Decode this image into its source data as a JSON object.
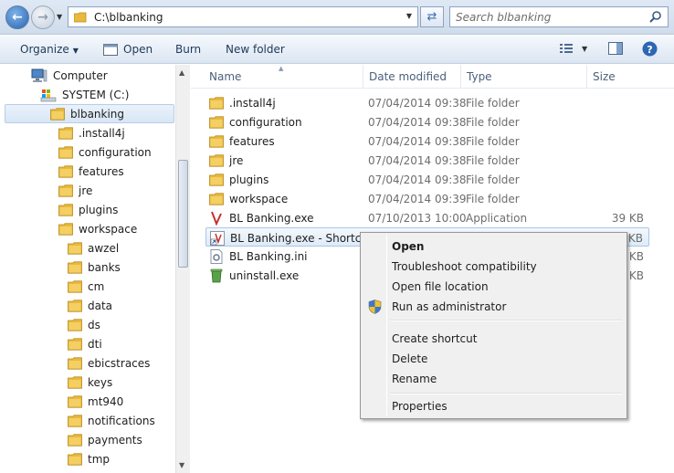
{
  "address": {
    "path": "C:\\blbanking"
  },
  "search": {
    "placeholder": "Search blbanking"
  },
  "toolbar": {
    "organize": "Organize",
    "open": "Open",
    "burn": "Burn",
    "new_folder": "New folder"
  },
  "nav_tree": [
    {
      "label": "Computer",
      "icon": "computer-icon",
      "indent": 0
    },
    {
      "label": "SYSTEM (C:)",
      "icon": "drive-icon",
      "indent": 1
    },
    {
      "label": "blbanking",
      "icon": "folder-icon",
      "indent": 2,
      "selected": true
    },
    {
      "label": ".install4j",
      "icon": "folder-icon",
      "indent": 3
    },
    {
      "label": "configuration",
      "icon": "folder-icon",
      "indent": 3
    },
    {
      "label": "features",
      "icon": "folder-icon",
      "indent": 3
    },
    {
      "label": "jre",
      "icon": "folder-icon",
      "indent": 3
    },
    {
      "label": "plugins",
      "icon": "folder-icon",
      "indent": 3
    },
    {
      "label": "workspace",
      "icon": "folder-icon",
      "indent": 3
    },
    {
      "label": "awzel",
      "icon": "folder-icon",
      "indent": 4
    },
    {
      "label": "banks",
      "icon": "folder-icon",
      "indent": 4
    },
    {
      "label": "cm",
      "icon": "folder-icon",
      "indent": 4
    },
    {
      "label": "data",
      "icon": "folder-icon",
      "indent": 4
    },
    {
      "label": "ds",
      "icon": "folder-icon",
      "indent": 4
    },
    {
      "label": "dti",
      "icon": "folder-icon",
      "indent": 4
    },
    {
      "label": "ebicstraces",
      "icon": "folder-icon",
      "indent": 4
    },
    {
      "label": "keys",
      "icon": "folder-icon",
      "indent": 4
    },
    {
      "label": "mt940",
      "icon": "folder-icon",
      "indent": 4
    },
    {
      "label": "notifications",
      "icon": "folder-icon",
      "indent": 4
    },
    {
      "label": "payments",
      "icon": "folder-icon",
      "indent": 4
    },
    {
      "label": "tmp",
      "icon": "folder-icon",
      "indent": 4
    }
  ],
  "columns": {
    "name": "Name",
    "date": "Date modified",
    "type": "Type",
    "size": "Size"
  },
  "files": [
    {
      "name": ".install4j",
      "date": "07/04/2014 09:38",
      "type": "File folder",
      "size": "",
      "icon": "folder-icon"
    },
    {
      "name": "configuration",
      "date": "07/04/2014 09:38",
      "type": "File folder",
      "size": "",
      "icon": "folder-icon"
    },
    {
      "name": "features",
      "date": "07/04/2014 09:38",
      "type": "File folder",
      "size": "",
      "icon": "folder-icon"
    },
    {
      "name": "jre",
      "date": "07/04/2014 09:38",
      "type": "File folder",
      "size": "",
      "icon": "folder-icon"
    },
    {
      "name": "plugins",
      "date": "07/04/2014 09:38",
      "type": "File folder",
      "size": "",
      "icon": "folder-icon"
    },
    {
      "name": "workspace",
      "date": "07/04/2014 09:39",
      "type": "File folder",
      "size": "",
      "icon": "folder-icon"
    },
    {
      "name": "BL Banking.exe",
      "date": "07/10/2013 10:00",
      "type": "Application",
      "size": "39 KB",
      "icon": "app-icon"
    },
    {
      "name": "BL Banking.exe - Shortcut",
      "date": "",
      "type": "",
      "size": "1 KB",
      "icon": "shortcut-icon",
      "selected": true
    },
    {
      "name": "BL Banking.ini",
      "date": "",
      "type": "",
      "size": "1 KB",
      "icon": "ini-file-icon"
    },
    {
      "name": "uninstall.exe",
      "date": "",
      "type": "",
      "size": "308 KB",
      "icon": "uninstall-icon"
    }
  ],
  "context_menu": {
    "open": "Open",
    "troubleshoot": "Troubleshoot compatibility",
    "open_location": "Open file location",
    "run_admin": "Run as administrator",
    "create_shortcut": "Create shortcut",
    "delete": "Delete",
    "rename": "Rename",
    "properties": "Properties"
  },
  "colors": {
    "folder": "#e8b93c",
    "accent": "#2a64b2",
    "selection": "#d8e6f5"
  }
}
